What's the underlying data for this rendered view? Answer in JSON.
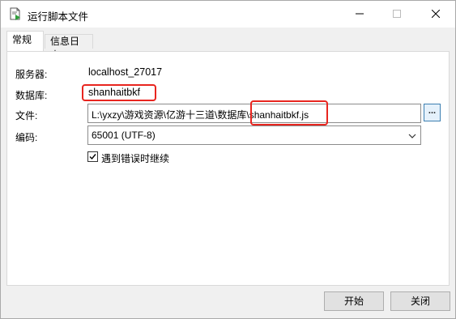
{
  "window": {
    "title": "运行脚本文件",
    "icon": "script-run-icon"
  },
  "tabs": [
    {
      "label": "常规",
      "active": true
    },
    {
      "label": "信息日志",
      "active": false
    }
  ],
  "form": {
    "server_label": "服务器:",
    "server_value": "localhost_27017",
    "database_label": "数据库:",
    "database_value": "shanhaitbkf",
    "file_label": "文件:",
    "file_path_prefix": "L:\\yxzy\\游戏资源\\亿游十三道\\数据库\\",
    "file_name": "shanhaitbkf.js",
    "browse_label": "...",
    "encoding_label": "编码:",
    "encoding_value": "65001 (UTF-8)",
    "continue_on_error_label": "遇到错误时继续",
    "continue_on_error_checked": true
  },
  "footer": {
    "start_label": "开始",
    "close_label": "关闭"
  },
  "colors": {
    "highlight": "#e8251f",
    "browse_border": "#3c7fb1"
  }
}
